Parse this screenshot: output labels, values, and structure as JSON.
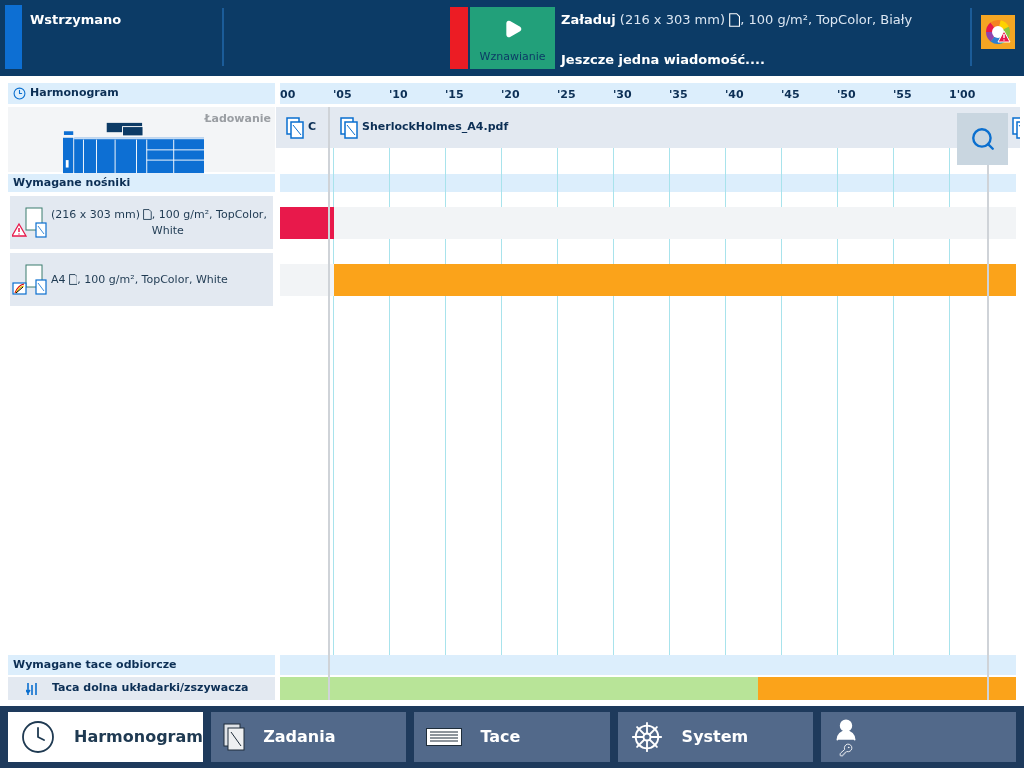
{
  "status_bar": {
    "state": "Wstrzymano",
    "resume_button": "Wznawianie",
    "message": {
      "action": "Załaduj",
      "size": "(216 x 303 mm)",
      "details": ", 100 g/m², TopColor, Biały"
    },
    "more_messages": "Jeszcze jedna wiadomość...."
  },
  "schedule": {
    "title": "Harmonogram",
    "printer_status": "Ładowanie",
    "ticks": [
      "00",
      "'05",
      "'10",
      "'15",
      "'20",
      "'25",
      "'30",
      "'35",
      "'40",
      "'45",
      "'50",
      "'55",
      "1'00"
    ],
    "jobs": [
      {
        "name": "C"
      },
      {
        "name": "SherlockHolmes_A4.pdf"
      }
    ],
    "media_title": "Wymagane nośniki",
    "media": [
      {
        "kind": "warning",
        "size": "(216 x 303 mm)",
        "details": ", 100 g/m², TopColor, White",
        "bar": {
          "kind": "start",
          "color": "#e8194b",
          "level": 0.073
        }
      },
      {
        "kind": "loaded",
        "size": "A4",
        "details": ", 100 g/m², TopColor, White",
        "bar": {
          "kind": "end",
          "color": "#fba31a",
          "level": 0.927
        }
      }
    ],
    "trays_title": "Wymagane tace odbiorcze",
    "trays": [
      {
        "name": "Taca dolna układarki/zszywacza",
        "bar": {
          "kind": "end",
          "color": "#fba31a",
          "level": 0.351
        }
      }
    ]
  },
  "nav": [
    {
      "label": "Harmonogram",
      "kind": "clock",
      "selected": true
    },
    {
      "label": "Zadania",
      "kind": "document",
      "selected": false
    },
    {
      "label": "Tace",
      "kind": "tray",
      "selected": false
    },
    {
      "label": "System",
      "kind": "wheel",
      "selected": false
    },
    {
      "kind": "user",
      "selected": false
    }
  ]
}
